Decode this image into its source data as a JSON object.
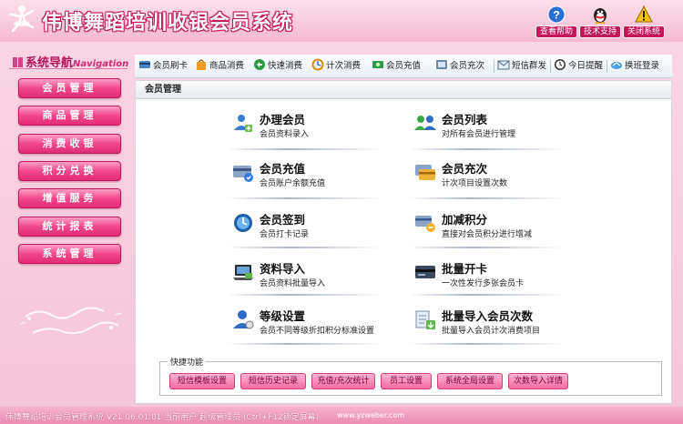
{
  "app": {
    "title": "伟博舞蹈培训收银会员系统"
  },
  "top_buttons": [
    {
      "label": "查看帮助",
      "icon": "help-icon",
      "color": "#2a6fd6"
    },
    {
      "label": "技术支持",
      "icon": "qq-penguin-icon",
      "color": "#222222"
    },
    {
      "label": "关闭系统",
      "icon": "warning-icon",
      "color": "#f6c400"
    }
  ],
  "sidebar": {
    "title": "系统导航",
    "title_sub": "Navigation",
    "items": [
      {
        "label": "会员管理"
      },
      {
        "label": "商品管理"
      },
      {
        "label": "消费收银"
      },
      {
        "label": "积分兑换"
      },
      {
        "label": "增值服务"
      },
      {
        "label": "统计报表"
      },
      {
        "label": "系统管理"
      }
    ]
  },
  "toolbar": {
    "items": [
      {
        "label": "会员刷卡",
        "icon": "card-swipe-icon"
      },
      {
        "label": "商品消费",
        "icon": "shopping-icon"
      },
      {
        "label": "快速消费",
        "icon": "quick-consume-icon"
      },
      {
        "label": "计次消费",
        "icon": "count-consume-icon"
      },
      {
        "label": "会员充值",
        "icon": "recharge-icon"
      },
      {
        "label": "会员充次",
        "icon": "recharge-times-icon"
      },
      {
        "label": "短信群发",
        "icon": "sms-icon"
      },
      {
        "label": "今日提醒",
        "icon": "clock-icon"
      },
      {
        "label": "换班登录",
        "icon": "shift-login-icon"
      }
    ]
  },
  "panel": {
    "title": "会员管理",
    "functions": [
      {
        "title": "办理会员",
        "desc": "会员资料录入",
        "icon": "add-member-icon"
      },
      {
        "title": "会员列表",
        "desc": "对所有会员进行管理",
        "icon": "member-list-icon"
      },
      {
        "title": "会员充值",
        "desc": "会员账户余额充值",
        "icon": "member-recharge-icon"
      },
      {
        "title": "会员充次",
        "desc": "计次项目设置次数",
        "icon": "member-times-icon"
      },
      {
        "title": "会员签到",
        "desc": "会员打卡记录",
        "icon": "sign-in-icon"
      },
      {
        "title": "加减积分",
        "desc": "直接对会员积分进行增减",
        "icon": "points-adjust-icon"
      },
      {
        "title": "资料导入",
        "desc": "会员资料批量导入",
        "icon": "laptop-import-icon"
      },
      {
        "title": "批量开卡",
        "desc": "一次性发行多张会员卡",
        "icon": "batch-card-icon"
      },
      {
        "title": "等级设置",
        "desc": "会员不同等级折扣积分标准设置",
        "icon": "level-setting-icon"
      },
      {
        "title": "批量导入会员次数",
        "desc": "批量导入会员计次消费项目",
        "icon": "batch-import-times-icon"
      }
    ]
  },
  "quick": {
    "legend": "快捷功能",
    "buttons": [
      {
        "label": "短信模板设置"
      },
      {
        "label": "短信历史记录"
      },
      {
        "label": "充值/充次统计"
      },
      {
        "label": "员工设置"
      },
      {
        "label": "系统全局设置"
      },
      {
        "label": "次数导入详情"
      }
    ]
  },
  "status": {
    "left": "伟博舞蹈培训会员管理系统 V21.06.01.01  当前用户 超级管理员 (Ctrl+F12锁定屏幕)",
    "right": "www.yzweber.com"
  }
}
